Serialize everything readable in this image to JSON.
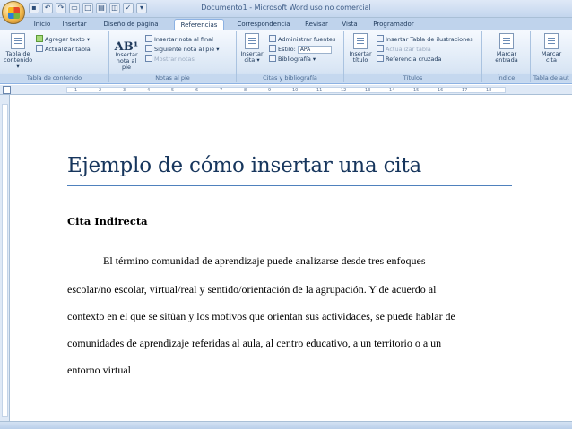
{
  "window": {
    "title": "Documento1 - Microsoft Word uso no comercial"
  },
  "quick_access": [
    "save-icon",
    "undo-icon",
    "redo-icon",
    "open-icon",
    "new-icon",
    "print-icon",
    "preview-icon",
    "spelling-icon",
    "customize-icon"
  ],
  "tabs": [
    {
      "label": "Inicio"
    },
    {
      "label": "Insertar"
    },
    {
      "label": "Diseño de página"
    },
    {
      "label": "Referencias",
      "active": true
    },
    {
      "label": "Correspondencia"
    },
    {
      "label": "Revisar"
    },
    {
      "label": "Vista"
    },
    {
      "label": "Programador"
    }
  ],
  "ribbon": {
    "toc": {
      "big_label": "Tabla de contenido ▾",
      "add_text": "Agregar texto ▾",
      "update_table": "Actualizar tabla",
      "group": "Tabla de contenido"
    },
    "footnotes": {
      "insert_footnote": "Insertar nota al pie",
      "insert_endnote": "Insertar nota al final",
      "next_footnote": "Siguiente nota al pie ▾",
      "show_notes": "Mostrar notas",
      "group": "Notas al pie"
    },
    "citations": {
      "insert_citation": "Insertar cita ▾",
      "manage_sources": "Administrar fuentes",
      "style_label": "Estilo:",
      "style_value": "APA",
      "bibliography": "Bibliografía ▾",
      "group": "Citas y bibliografía"
    },
    "captions": {
      "insert_title": "Insertar título",
      "insert_table_of_figures": "Insertar Tabla de ilustraciones",
      "update_table": "Actualizar tabla",
      "cross_reference": "Referencia cruzada",
      "group": "Títulos"
    },
    "index": {
      "mark_entry": "Marcar entrada",
      "group": "Índice"
    },
    "authorities": {
      "mark_citation": "Marcar cita",
      "group": "Tabla de aut"
    }
  },
  "ruler": {
    "marks": [
      "1",
      "2",
      "3",
      "4",
      "5",
      "6",
      "7",
      "8",
      "9",
      "10",
      "11",
      "12",
      "13",
      "14",
      "15",
      "16",
      "17",
      "18"
    ]
  },
  "document": {
    "title": "Ejemplo de cómo insertar una cita",
    "heading": "Cita Indirecta",
    "lines": [
      "El término comunidad de aprendizaje puede analizarse desde tres enfoques",
      "escolar/no escolar, virtual/real y sentido/orientación de la agrupación. Y de acuerdo al",
      "contexto en el que se sitúan y los motivos que orientan sus actividades, se puede hablar de",
      "comunidades de aprendizaje referidas al aula, al centro educativo, a un territorio o a un",
      "entorno virtual"
    ]
  },
  "colors": {
    "title": "#17365d",
    "rule": "#4f81bd",
    "ribbon": "#dbe7f5"
  }
}
